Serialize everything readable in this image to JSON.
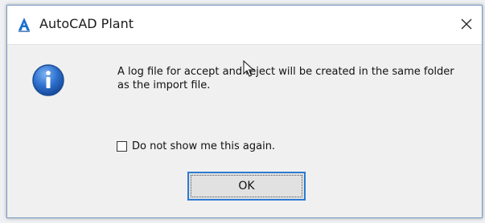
{
  "window": {
    "title": "AutoCAD Plant",
    "app_icon": "autocad-a-icon",
    "close_icon": "close-icon"
  },
  "message": {
    "icon": "info-icon",
    "text": "A log file for accept and reject will be created in the same folder as the import file."
  },
  "checkbox": {
    "label": "Do not show me this again.",
    "checked": false
  },
  "buttons": {
    "ok_label": "OK"
  },
  "colors": {
    "accent": "#2c7bd1",
    "info_blue": "#1f5fbf"
  }
}
